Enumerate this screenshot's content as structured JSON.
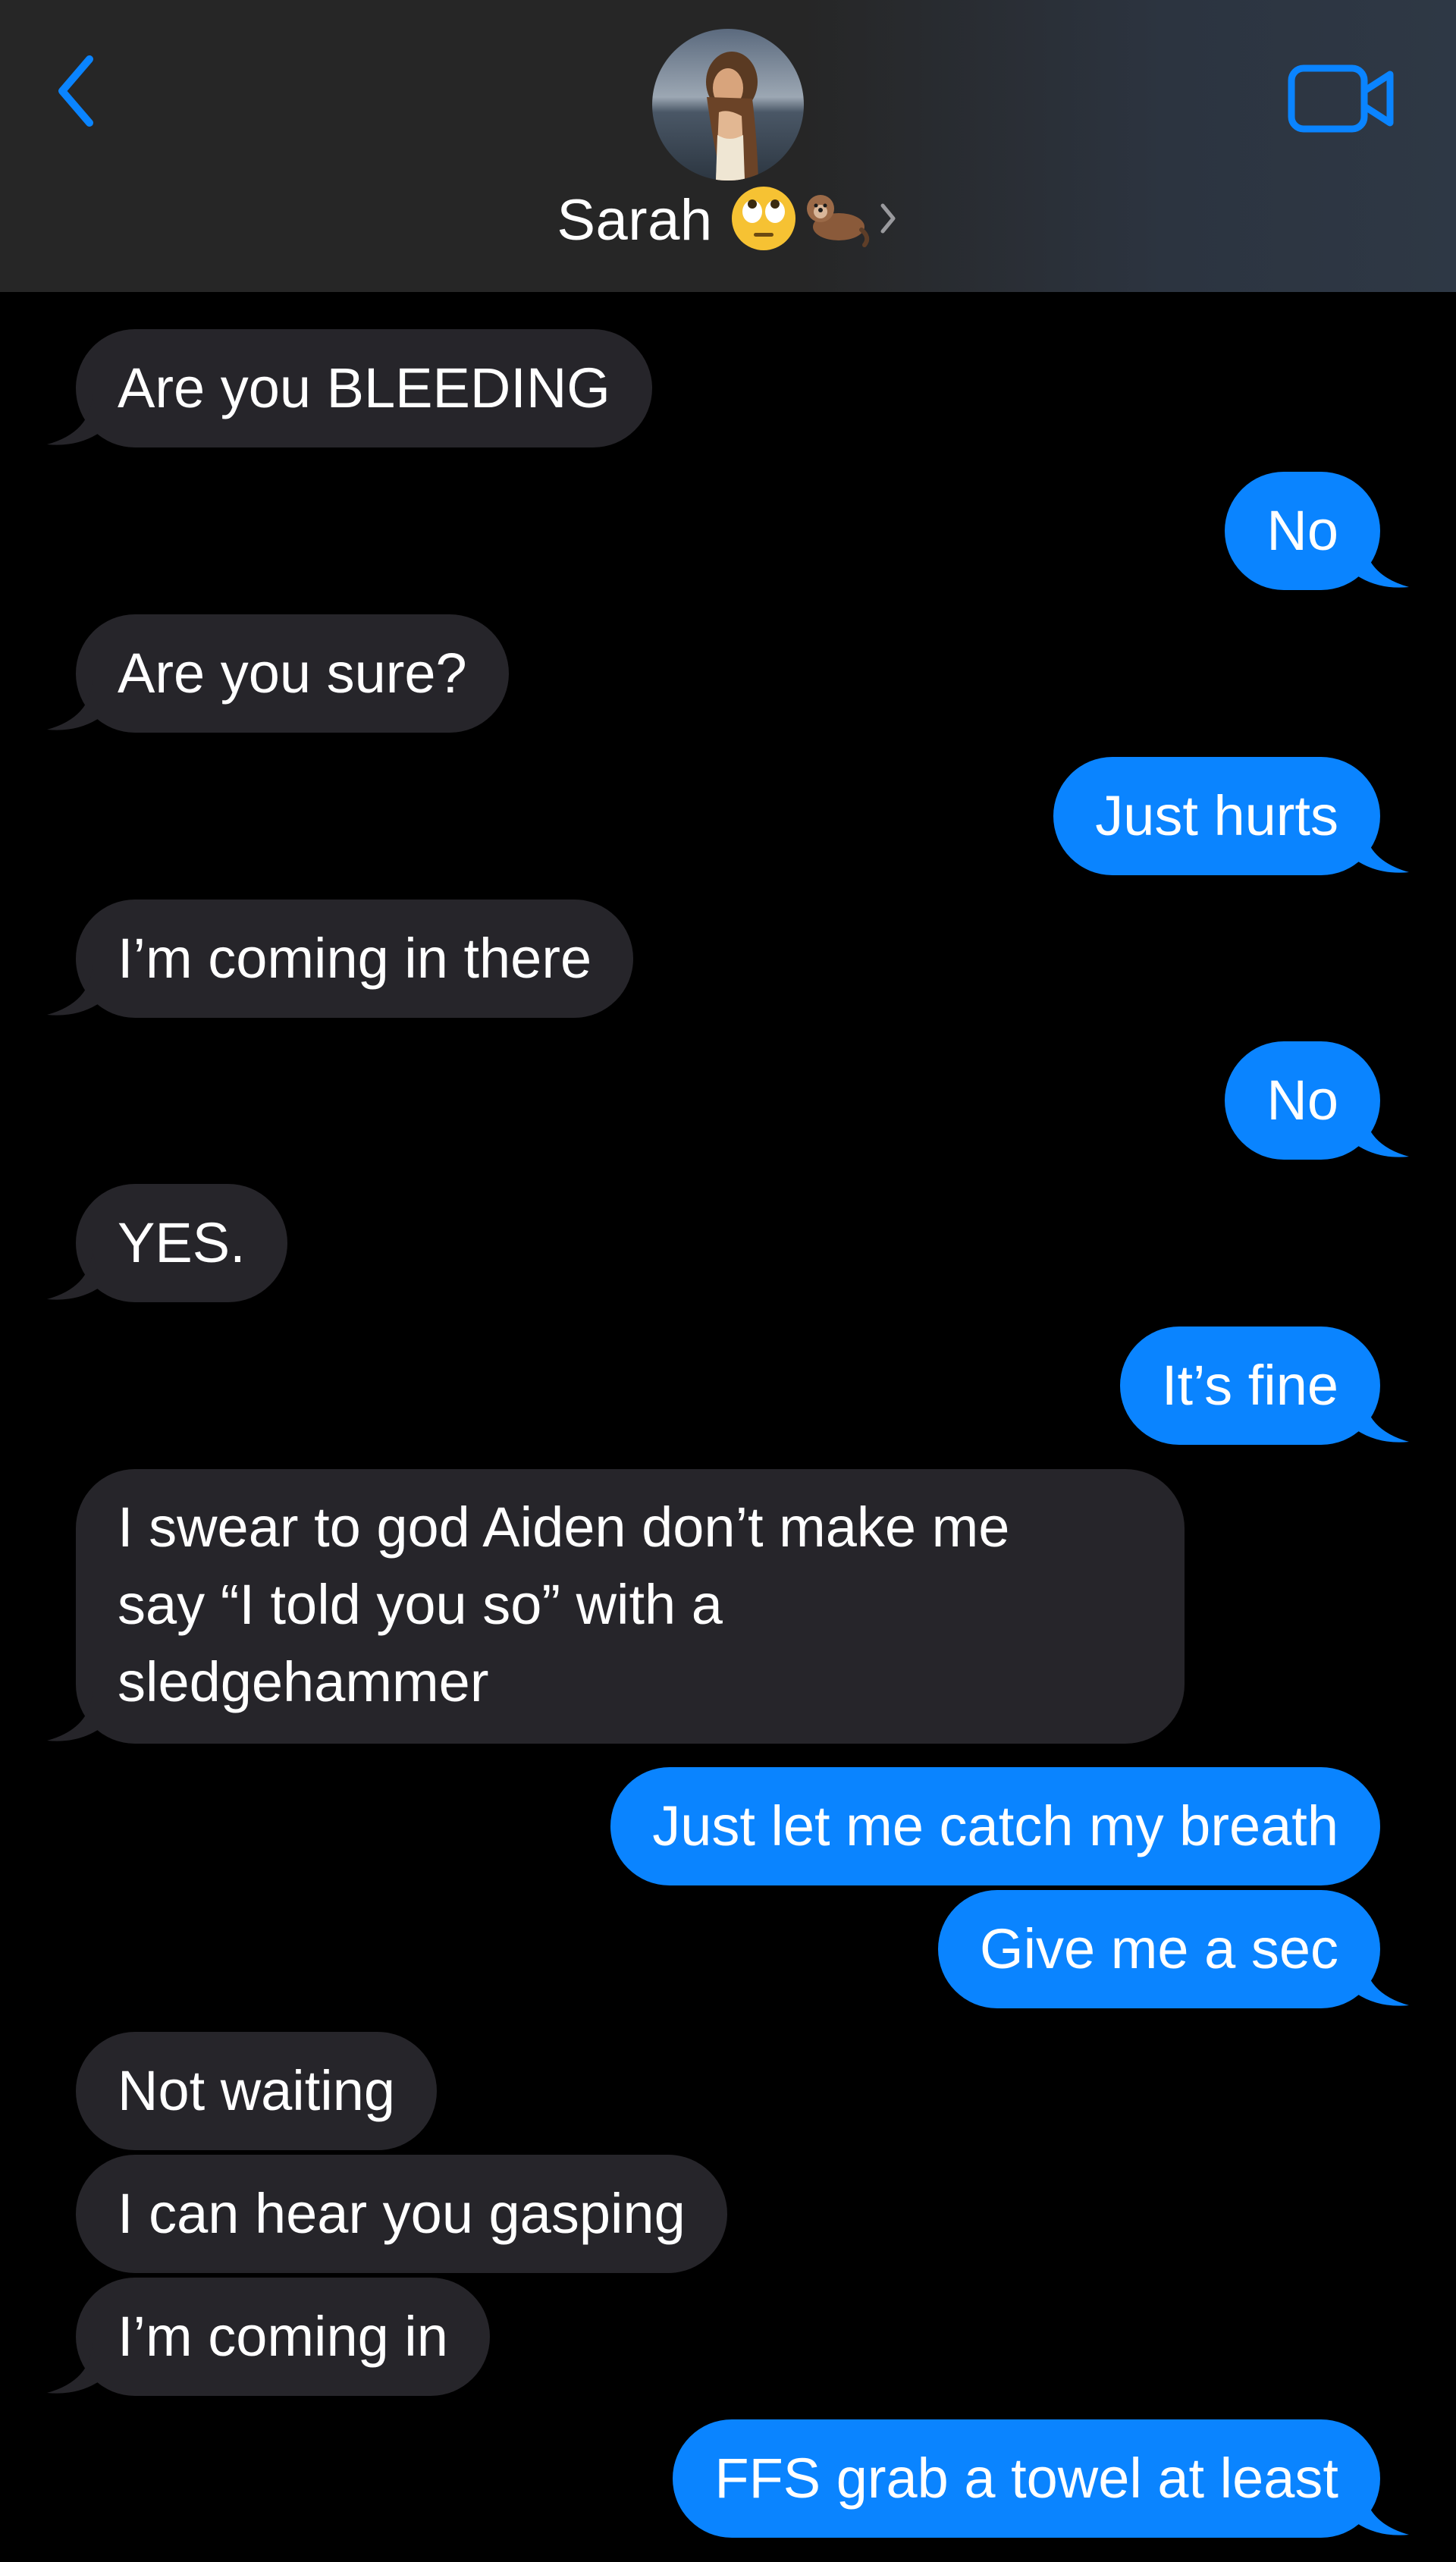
{
  "header": {
    "contact_name": "Sarah",
    "contact_emoji_icons": [
      "face-with-rolling-eyes",
      "otter"
    ],
    "back_icon": "chevron-left-icon",
    "video_icon": "video-camera-icon",
    "accent_color": "#0a84ff"
  },
  "colors": {
    "sent_bubble": "#0a84ff",
    "received_bubble": "#26252a",
    "background": "#000000"
  },
  "messages": [
    {
      "from": "them",
      "text": "Are you BLEEDING"
    },
    {
      "from": "me",
      "text": "No"
    },
    {
      "from": "them",
      "text": "Are you sure?"
    },
    {
      "from": "me",
      "text": "Just hurts"
    },
    {
      "from": "them",
      "text": "I’m coming in there"
    },
    {
      "from": "me",
      "text": "No"
    },
    {
      "from": "them",
      "text": "YES."
    },
    {
      "from": "me",
      "text": "It’s fine"
    },
    {
      "from": "them",
      "text": "I swear to god Aiden don’t make me say “I told you so” with a sledgehammer"
    },
    {
      "from": "me",
      "text": "Just let me catch my breath"
    },
    {
      "from": "me",
      "text": "Give me a sec"
    },
    {
      "from": "them",
      "text": "Not waiting"
    },
    {
      "from": "them",
      "text": "I can hear you gasping"
    },
    {
      "from": "them",
      "text": "I’m coming in"
    },
    {
      "from": "me",
      "text": "FFS grab a towel at least"
    }
  ]
}
